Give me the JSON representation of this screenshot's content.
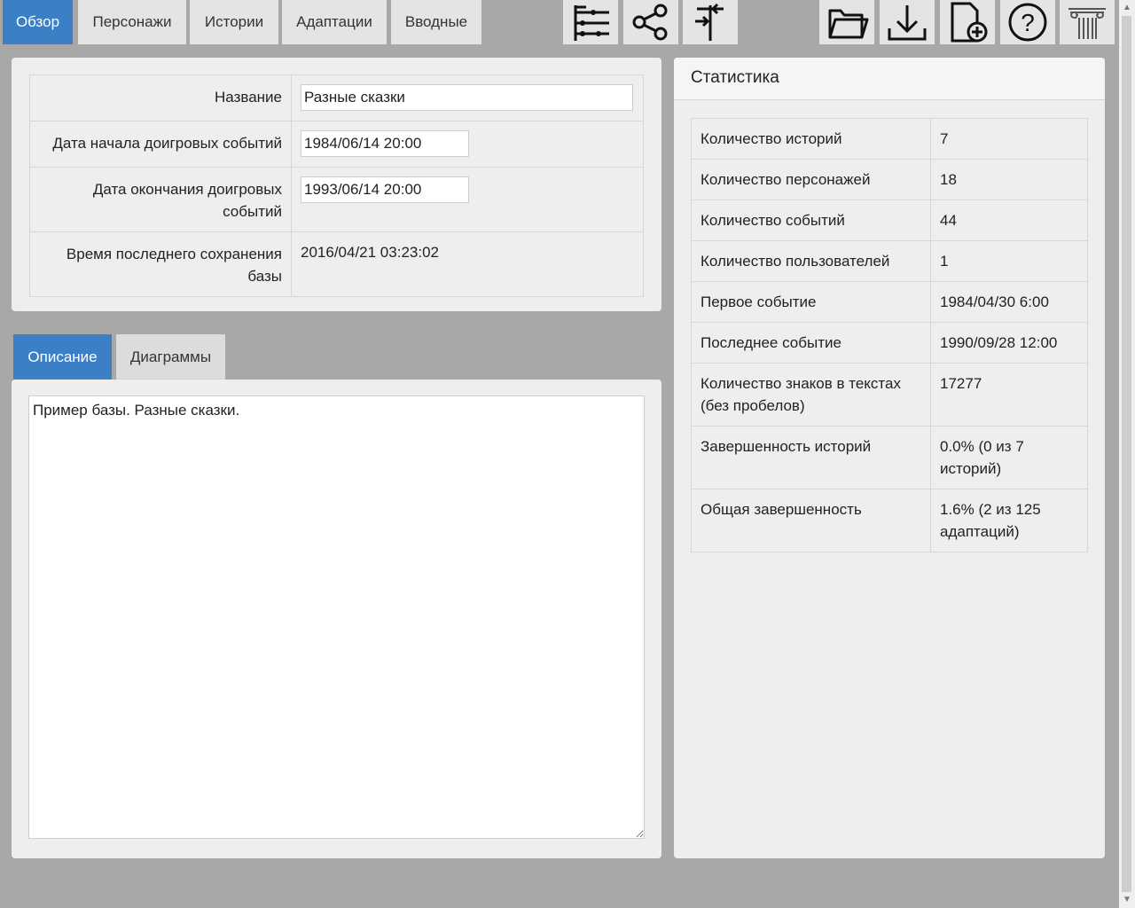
{
  "nav": {
    "tabs": [
      {
        "label": "Обзор",
        "active": true
      },
      {
        "label": "Персонажи"
      },
      {
        "label": "Истории"
      },
      {
        "label": "Адаптации"
      },
      {
        "label": "Вводные"
      }
    ],
    "icons": [
      "timeline-icon",
      "share-icon",
      "signpost-icon",
      "open-folder-icon",
      "download-icon",
      "new-file-icon",
      "help-icon",
      "pillar-logo-icon"
    ]
  },
  "overview": {
    "name_label": "Название",
    "name_value": "Разные сказки",
    "start_label": "Дата начала доигровых событий",
    "start_value": "1984/06/14 20:00",
    "end_label": "Дата окончания доигровых событий",
    "end_value": "1993/06/14 20:00",
    "saved_label": "Время последнего сохранения базы",
    "saved_value": "2016/04/21 03:23:02"
  },
  "subtabs": {
    "description": "Описание",
    "diagrams": "Диаграммы"
  },
  "description_text": "Пример базы. Разные сказки.",
  "stats": {
    "title": "Статистика",
    "rows": [
      {
        "k": "Количество историй",
        "v": "7"
      },
      {
        "k": "Количество персонажей",
        "v": "18"
      },
      {
        "k": "Количество событий",
        "v": "44"
      },
      {
        "k": "Количество пользователей",
        "v": "1"
      },
      {
        "k": "Первое событие",
        "v": "1984/04/30 6:00"
      },
      {
        "k": "Последнее событие",
        "v": "1990/09/28 12:00"
      },
      {
        "k": "Количество знаков в текстах (без пробелов)",
        "v": "17277"
      },
      {
        "k": "Завершенность историй",
        "v": "0.0% (0 из 7 историй)"
      },
      {
        "k": "Общая завершенность",
        "v": "1.6% (2 из 125 адаптаций)"
      }
    ]
  },
  "colors": {
    "accent": "#3b7fc4",
    "background": "#a8a8a8",
    "panel": "#eeeeee"
  }
}
